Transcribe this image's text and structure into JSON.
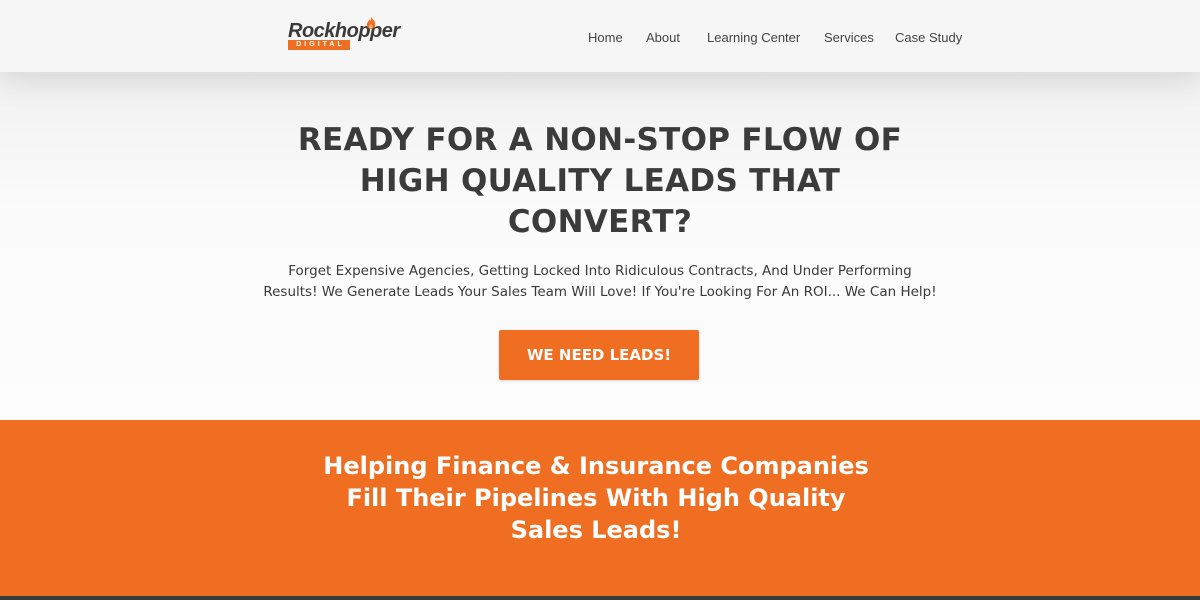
{
  "header": {
    "logo": {
      "name": "Rockhopper",
      "sub": "DIGITAL"
    },
    "nav": [
      {
        "label": "Home"
      },
      {
        "label": "About"
      },
      {
        "label": "Learning Center"
      },
      {
        "label": "Services"
      },
      {
        "label": "Case Study"
      }
    ]
  },
  "hero": {
    "headline_lines": [
      "READY FOR A NON-STOP FLOW OF",
      "HIGH QUALITY LEADS THAT",
      "CONVERT?"
    ],
    "subtext_lines": [
      "Forget Expensive Agencies, Getting Locked Into Ridiculous Contracts, And Under Performing",
      "Results! We Generate Leads Your Sales Team Will Love! If You're Looking For An ROI... We Can Help!"
    ],
    "cta_label": "WE NEED LEADS!"
  },
  "banner": {
    "lines": [
      "Helping Finance & Insurance Companies",
      "Fill Their Pipelines With High Quality",
      "Sales Leads!"
    ]
  },
  "colors": {
    "accent": "#f06e21",
    "text_dark": "#3b3b3b",
    "header_bg": "#f6f6f6"
  },
  "icons": {
    "logo_flame": "flame-icon"
  }
}
